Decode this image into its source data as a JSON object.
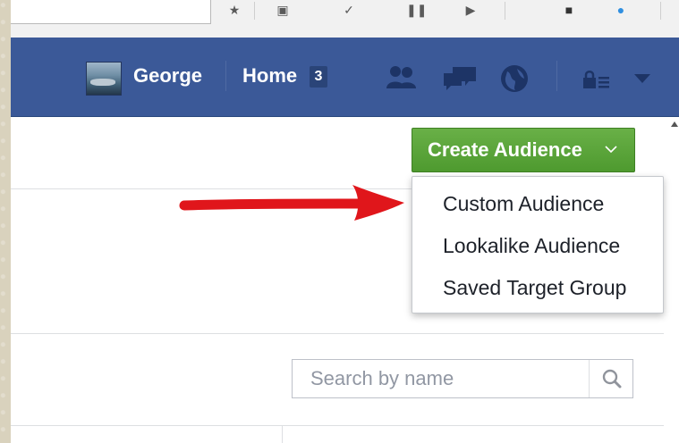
{
  "header": {
    "user_name": "George",
    "home_label": "Home",
    "home_count": "3",
    "icons": [
      "friend-requests-icon",
      "messages-icon",
      "notifications-globe-icon",
      "privacy-lock-icon",
      "account-menu-chevron-icon"
    ]
  },
  "audience": {
    "create_button_label": "Create Audience",
    "dropdown_items": [
      {
        "label": "Custom Audience"
      },
      {
        "label": "Lookalike Audience"
      },
      {
        "label": "Saved Target Group"
      }
    ]
  },
  "search": {
    "placeholder": "Search by name"
  },
  "colors": {
    "header_blue": "#3b5998",
    "button_green": "#5aa63a",
    "annotation_arrow": "#e0161b"
  }
}
